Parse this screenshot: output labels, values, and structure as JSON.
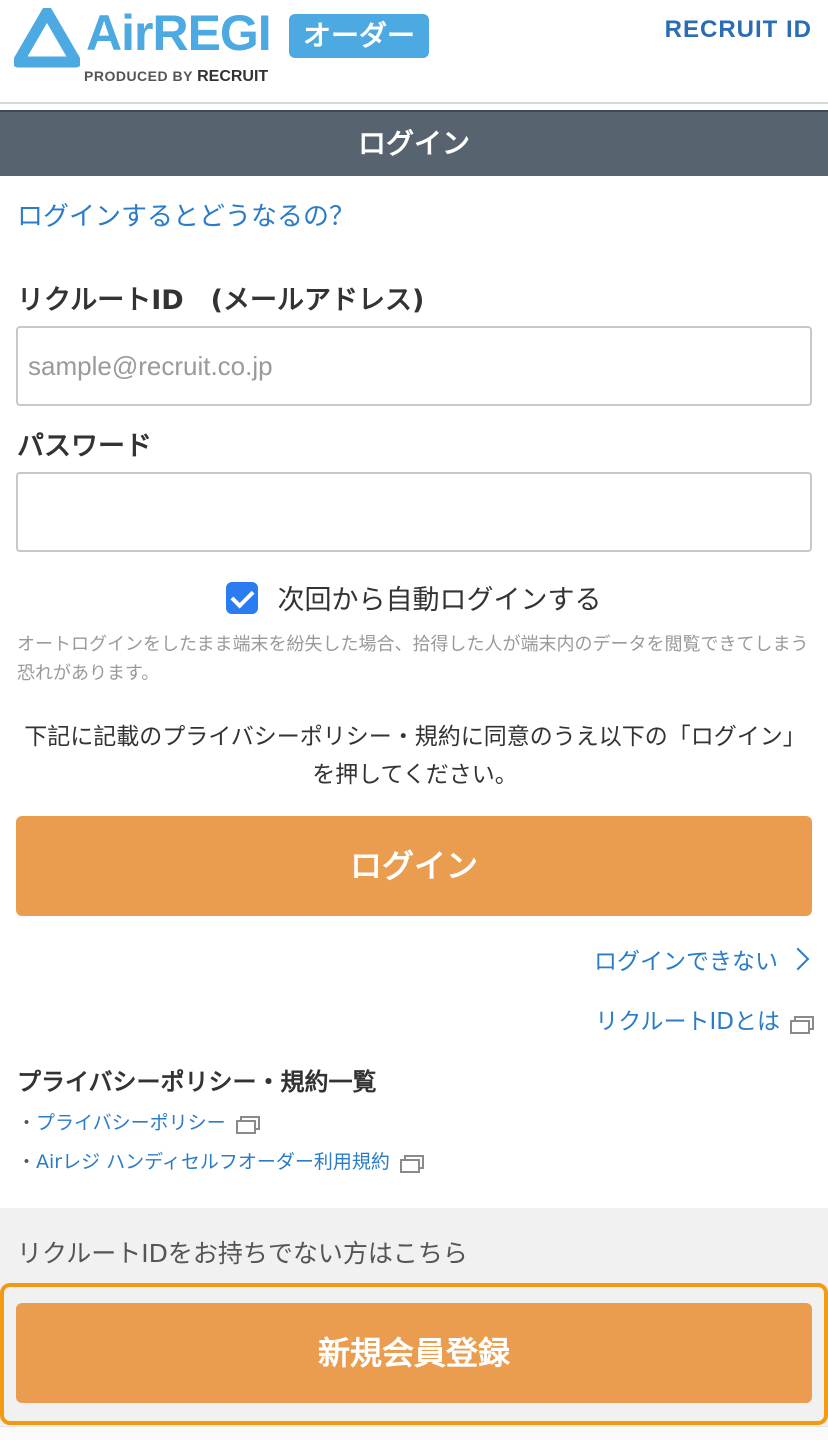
{
  "header": {
    "logo_text": "AirREGI",
    "logo_badge": "オーダー",
    "logo_sub_prefix": "PRODUCED BY",
    "logo_sub_brand": "RECRUIT",
    "recruit_id": "RECRUIT ID"
  },
  "titlebar": {
    "title": "ログイン"
  },
  "what_link": "ログインするとどうなるの？",
  "email": {
    "label": "リクルートID　(メールアドレス)",
    "placeholder": "sample@recruit.co.jp",
    "value": ""
  },
  "password": {
    "label": "パスワード",
    "value": ""
  },
  "remember": {
    "label": "次回から自動ログインする",
    "checked": true
  },
  "note": "オートログインをしたまま端末を紛失した場合、拾得した人が端末内のデータを閲覧できてしまう恐れがあります。",
  "agree_text": "下記に記載のプライバシーポリシー・規約に同意のうえ以下の「ログイン」を押してください。",
  "login_button": "ログイン",
  "cannot_login_link": "ログインできない",
  "what_is_id_link": "リクルートIDとは",
  "policy": {
    "heading": "プライバシーポリシー・規約一覧",
    "bullet": "・",
    "items": [
      {
        "label": "プライバシーポリシー"
      },
      {
        "label": "Airレジ ハンディセルフオーダー利用規約"
      }
    ]
  },
  "no_id_text": "リクルートIDをお持ちでない方はこちら",
  "register_button": "新規会員登録",
  "colors": {
    "brand": "#4ca9e1",
    "link": "#2a7cc7",
    "button": "#eb9d4f",
    "titlebar": "#576470",
    "highlight": "#f49a11",
    "checkbox": "#2a7cf0"
  }
}
